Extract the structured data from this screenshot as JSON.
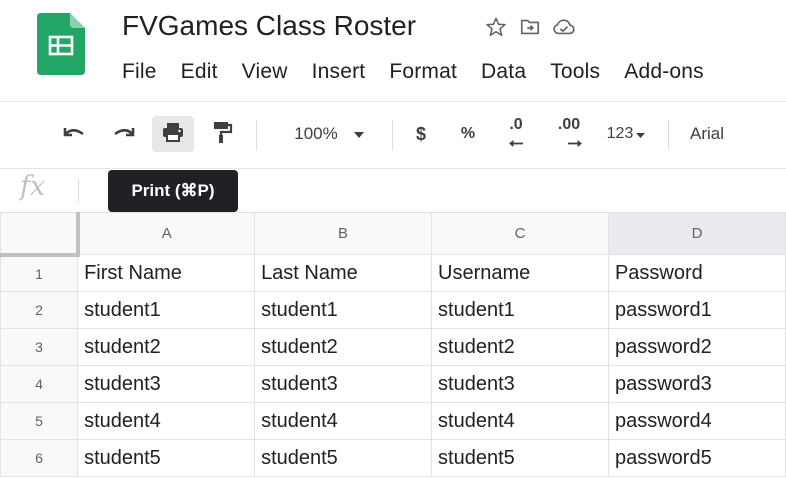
{
  "document": {
    "title": "FVGames Class Roster",
    "app_icon": "google-sheets-icon",
    "title_icons": [
      "star-icon",
      "move-to-folder-icon",
      "cloud-saved-icon"
    ]
  },
  "menu": [
    "File",
    "Edit",
    "View",
    "Insert",
    "Format",
    "Data",
    "Tools",
    "Add-ons"
  ],
  "toolbar": {
    "undo_icon": "undo-icon",
    "redo_icon": "redo-icon",
    "print_icon": "print-icon",
    "paint_format_icon": "paint-format-icon",
    "zoom": "100%",
    "currency": "$",
    "percent": "%",
    "decrease_decimals": ".0",
    "increase_decimals": ".00",
    "more_formats": "123",
    "font": "Arial"
  },
  "formula_bar": {
    "label": "fx"
  },
  "tooltip": {
    "text": "Print (⌘P)"
  },
  "sheet": {
    "columns": [
      "A",
      "B",
      "C",
      "D"
    ],
    "row_numbers": [
      "1",
      "2",
      "3",
      "4",
      "5",
      "6"
    ],
    "rows": [
      [
        "First Name",
        "Last Name",
        "Username",
        "Password"
      ],
      [
        "student1",
        "student1",
        "student1",
        "password1"
      ],
      [
        "student2",
        "student2",
        "student2",
        "password2"
      ],
      [
        "student3",
        "student3",
        "student3",
        "password3"
      ],
      [
        "student4",
        "student4",
        "student4",
        "password4"
      ],
      [
        "student5",
        "student5",
        "student5",
        "password5"
      ]
    ]
  },
  "colors": {
    "sheets_green": "#23a566",
    "tooltip_bg": "#202124",
    "header_bg": "#f8f9fa",
    "selected_header_bg": "#e8eaed"
  }
}
